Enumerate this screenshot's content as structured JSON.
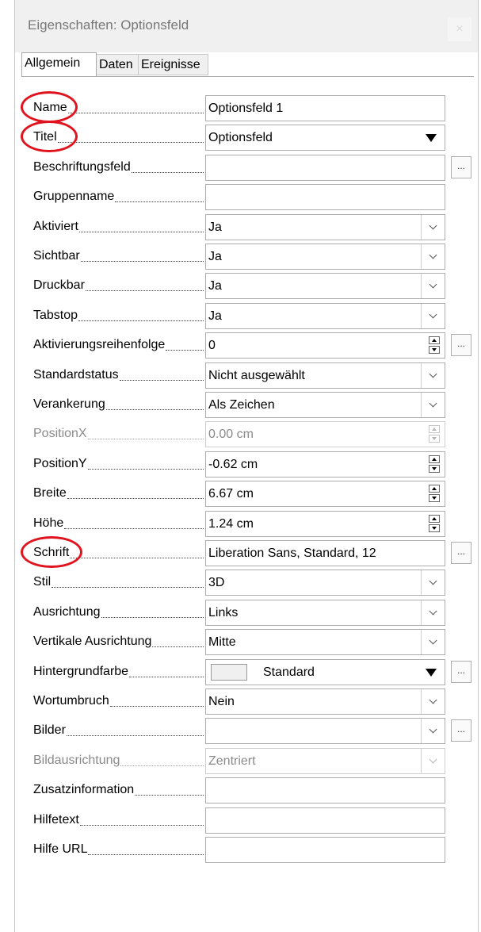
{
  "window": {
    "title": "Eigenschaften: Optionsfeld",
    "close_label": "×"
  },
  "tabs": [
    {
      "label": "Allgemein",
      "active": true
    },
    {
      "label": "Daten",
      "active": false
    },
    {
      "label": "Ereignisse",
      "active": false
    }
  ],
  "rows": [
    {
      "key": "name",
      "label": "Name",
      "control": "text",
      "value": "Optionsfeld 1",
      "highlighted": true
    },
    {
      "key": "titel",
      "label": "Titel",
      "control": "combo",
      "value": "Optionsfeld",
      "highlighted": true
    },
    {
      "key": "beschriftungsfeld",
      "label": "Beschriftungsfeld",
      "control": "text",
      "value": "",
      "has_button": true
    },
    {
      "key": "gruppenname",
      "label": "Gruppenname",
      "control": "text",
      "value": ""
    },
    {
      "key": "aktiviert",
      "label": "Aktiviert",
      "control": "dropdown",
      "value": "Ja"
    },
    {
      "key": "sichtbar",
      "label": "Sichtbar",
      "control": "dropdown",
      "value": "Ja"
    },
    {
      "key": "druckbar",
      "label": "Druckbar",
      "control": "dropdown",
      "value": "Ja"
    },
    {
      "key": "tabstop",
      "label": "Tabstop",
      "control": "dropdown",
      "value": "Ja"
    },
    {
      "key": "aktivierungsreihenfolge",
      "label": "Aktivierungsreihenfolge",
      "control": "spin",
      "value": "0",
      "has_button": true
    },
    {
      "key": "standardstatus",
      "label": "Standardstatus",
      "control": "dropdown",
      "value": "Nicht ausgewählt"
    },
    {
      "key": "verankerung",
      "label": "Verankerung",
      "control": "dropdown",
      "value": "Als Zeichen"
    },
    {
      "key": "positionx",
      "label": "PositionX",
      "control": "spin",
      "value": "0.00 cm",
      "disabled": true
    },
    {
      "key": "positiony",
      "label": "PositionY",
      "control": "spin",
      "value": "-0.62 cm"
    },
    {
      "key": "breite",
      "label": "Breite",
      "control": "spin",
      "value": "6.67 cm"
    },
    {
      "key": "hoehe",
      "label": "Höhe",
      "control": "spin",
      "value": "1.24 cm"
    },
    {
      "key": "schrift",
      "label": "Schrift",
      "control": "text",
      "value": "Liberation Sans, Standard, 12",
      "has_button": true,
      "highlighted": true
    },
    {
      "key": "stil",
      "label": "Stil",
      "control": "dropdown",
      "value": "3D"
    },
    {
      "key": "ausrichtung",
      "label": "Ausrichtung",
      "control": "dropdown",
      "value": "Links"
    },
    {
      "key": "vertikale_ausrichtung",
      "label": "Vertikale Ausrichtung",
      "control": "dropdown",
      "value": "Mitte"
    },
    {
      "key": "hintergrundfarbe",
      "label": "Hintergrundfarbe",
      "control": "color",
      "value": "Standard",
      "swatch_color": "#f0f0f0",
      "has_button": true
    },
    {
      "key": "wortumbruch",
      "label": "Wortumbruch",
      "control": "dropdown",
      "value": "Nein"
    },
    {
      "key": "bilder",
      "label": "Bilder",
      "control": "dropdown",
      "value": "",
      "has_button": true
    },
    {
      "key": "bildausrichtung",
      "label": "Bildausrichtung",
      "control": "dropdown",
      "value": "Zentriert",
      "disabled": true
    },
    {
      "key": "zusatzinformation",
      "label": "Zusatzinformation",
      "control": "text",
      "value": ""
    },
    {
      "key": "hilfetext",
      "label": "Hilfetext",
      "control": "text",
      "value": ""
    },
    {
      "key": "hilfe_url",
      "label": "Hilfe URL",
      "control": "text",
      "value": ""
    }
  ],
  "button_label": "...",
  "colors": {
    "highlight_circle": "#e0141e",
    "disabled_text": "#8a8a8a"
  }
}
